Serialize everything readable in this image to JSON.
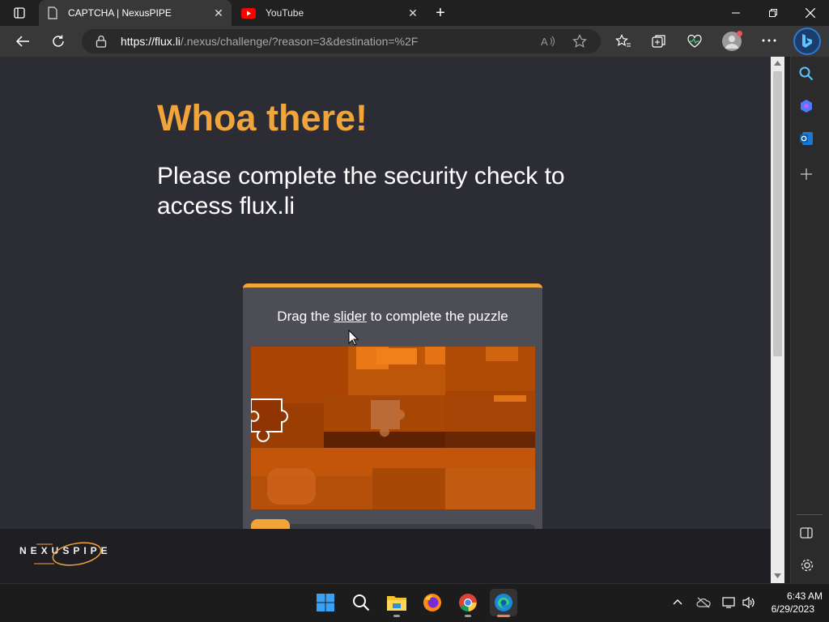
{
  "browser": {
    "tabs": [
      {
        "title": "CAPTCHA | NexusPIPE",
        "icon": "page-icon",
        "active": true
      },
      {
        "title": "YouTube",
        "icon": "youtube-icon",
        "active": false
      }
    ],
    "new_tab_symbol": "+",
    "url_host": "https://flux.li",
    "url_path": "/.nexus/challenge/?reason=3&destination=%2F"
  },
  "page": {
    "headline": "Whoa there!",
    "subtitle": "Please complete the security check to access flux.li",
    "captcha": {
      "instruction_before": "Drag the ",
      "instruction_link": "slider",
      "instruction_after": " to complete the puzzle"
    },
    "footer_logo": "NEXUSPIPE"
  },
  "taskbar": {
    "time": "6:43 AM",
    "date": "6/29/2023"
  },
  "colors": {
    "accent": "#f0a43a",
    "page_bg": "#2c2c34",
    "card_bg": "#4d4d55"
  }
}
